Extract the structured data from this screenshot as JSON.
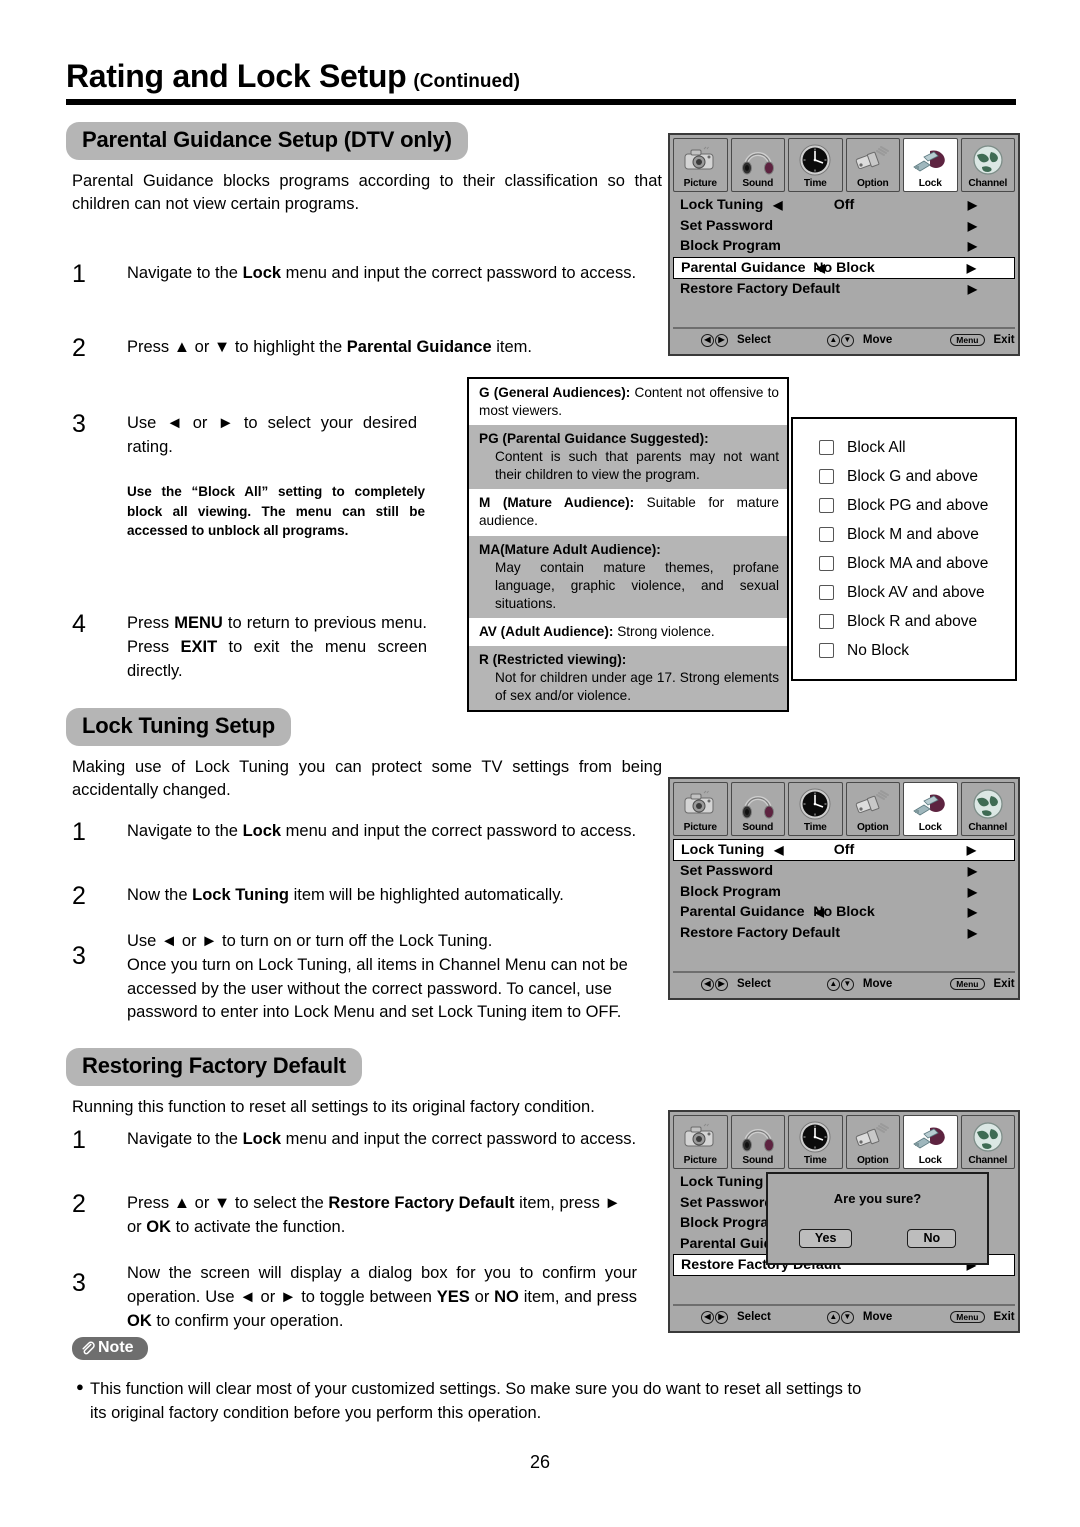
{
  "header": {
    "title": "Rating and Lock Setup",
    "continued": "(Continued)"
  },
  "sections": {
    "parental": {
      "pill": "Parental Guidance Setup (DTV only)",
      "intro": "Parental Guidance blocks programs according to their classification so that children can not view certain programs.",
      "steps": [
        {
          "num": "1",
          "text_html": "Navigate to the <b>Lock</b> menu and input the correct password to access."
        },
        {
          "num": "2",
          "text_html": "Press ▲ or ▼ to highlight the <b>Parental Guidance</b> item."
        },
        {
          "num": "3",
          "text_html": "Use ◄ or ► to select your desired rating."
        },
        {
          "num": "4",
          "text_html": "Press <b>MENU</b> to return to previous menu. Press <b>EXIT</b> to exit the menu screen directly."
        }
      ],
      "note_bold": "Use the “Block All” setting to completely block all viewing. The menu can still be accessed to unblock all programs."
    },
    "lock_tuning": {
      "pill": "Lock Tuning Setup",
      "intro": "Making use of Lock Tuning you can protect some TV settings from being accidentally changed.",
      "steps": [
        {
          "num": "1",
          "text_html": "Navigate to the <b>Lock</b> menu and input the correct password to access."
        },
        {
          "num": "2",
          "text_html": "Now the <b>Lock Tuning</b> item will be highlighted automatically."
        },
        {
          "num": "3",
          "text_html": "Use ◄ or ► to turn on or turn off the Lock Tuning.<br>Once you turn on Lock Tuning, all items in Channel Menu can not be accessed by the user without the correct password. To cancel, use password to enter into Lock Menu and set Lock Tuning item to OFF."
        }
      ]
    },
    "restoring": {
      "pill": "Restoring Factory Default",
      "intro": "Running this function to reset all settings to its original factory condition.",
      "steps": [
        {
          "num": "1",
          "text_html": "Navigate to the <b>Lock</b> menu and input the correct password to access."
        },
        {
          "num": "2",
          "text_html": "Press ▲ or ▼ to select the <b>Restore Factory Default</b> item, press ► or <b>OK</b> to activate the function."
        },
        {
          "num": "3",
          "text_html": "Now the screen will display a dialog box for you to confirm your operation. Use ◄ or ► to toggle between <b>YES</b> or <b>NO</b> item, and press <b>OK</b> to confirm your operation."
        }
      ]
    }
  },
  "ratings_table": {
    "rows": [
      {
        "code": "G (General Audiences):",
        "desc": " Content not offensive to most viewers.",
        "shaded": false,
        "hanging": false
      },
      {
        "code": "PG (Parental Guidance Suggested):",
        "desc": "Content is such that parents may not want their children to view the program.",
        "shaded": true,
        "hanging": true
      },
      {
        "code": "M (Mature Audience):",
        "desc": " Suitable for mature audience.",
        "shaded": false,
        "hanging": false
      },
      {
        "code": "MA(Mature Adult Audience):",
        "desc": " May contain mature themes, profane language, graphic violence, and sexual situations.",
        "shaded": true,
        "hanging": true
      },
      {
        "code": "AV (Adult Audience):",
        "desc": " Strong violence.",
        "shaded": false,
        "hanging": false
      },
      {
        "code": "R (Restricted viewing):",
        "desc": " Not for children under age 17. Strong elements of sex and/or violence.",
        "shaded": true,
        "hanging": true
      }
    ]
  },
  "block_options": [
    "Block All",
    "Block G and above",
    "Block PG and above",
    "Block M and above",
    "Block MA and above",
    "Block AV and above",
    "Block R and above",
    "No Block"
  ],
  "osd": {
    "tabs": [
      {
        "label": "Picture",
        "icon": "camera-icon",
        "active": false
      },
      {
        "label": "Sound",
        "icon": "headphones-icon",
        "active": false
      },
      {
        "label": "Time",
        "icon": "clock-icon",
        "active": false
      },
      {
        "label": "Option",
        "icon": "connector-icon",
        "active": false
      },
      {
        "label": "Lock",
        "icon": "padlock-icon",
        "active": true
      },
      {
        "label": "Channel",
        "icon": "globe-icon",
        "active": false
      }
    ],
    "footer": {
      "select": "Select",
      "move": "Move",
      "menu_key": "Menu",
      "exit": "Exit"
    },
    "menu1": {
      "rows": [
        {
          "name": "Lock Tuning",
          "left_arrow": true,
          "value": "Off",
          "right_arrow": true,
          "selected": false
        },
        {
          "name": "Set Password",
          "left_arrow": false,
          "value": "",
          "right_arrow": true,
          "selected": false
        },
        {
          "name": "Block Program",
          "left_arrow": false,
          "value": "",
          "right_arrow": true,
          "selected": false
        },
        {
          "name": "Parental Guidance",
          "left_arrow": true,
          "value": "No Block",
          "right_arrow": true,
          "selected": true
        },
        {
          "name": "Restore Factory Default",
          "left_arrow": false,
          "value": "",
          "right_arrow": true,
          "selected": false
        }
      ]
    },
    "menu2": {
      "rows": [
        {
          "name": "Lock Tuning",
          "left_arrow": true,
          "value": "Off",
          "right_arrow": true,
          "selected": true
        },
        {
          "name": "Set Password",
          "left_arrow": false,
          "value": "",
          "right_arrow": true,
          "selected": false
        },
        {
          "name": "Block Program",
          "left_arrow": false,
          "value": "",
          "right_arrow": true,
          "selected": false
        },
        {
          "name": "Parental Guidance",
          "left_arrow": true,
          "value": "No Block",
          "right_arrow": true,
          "selected": false
        },
        {
          "name": "Restore Factory Default",
          "left_arrow": false,
          "value": "",
          "right_arrow": true,
          "selected": false
        }
      ]
    },
    "menu3": {
      "rows": [
        {
          "name": "Lock Tuning",
          "left_arrow": false,
          "value": "",
          "right_arrow": false,
          "selected": false
        },
        {
          "name": "Set Password",
          "left_arrow": false,
          "value": "",
          "right_arrow": false,
          "selected": false
        },
        {
          "name": "Block Program",
          "left_arrow": false,
          "value": "",
          "right_arrow": false,
          "selected": false
        },
        {
          "name": "Parental Guidance",
          "left_arrow": false,
          "value": "",
          "right_arrow": false,
          "selected": false
        },
        {
          "name": "Restore Factory Default",
          "left_arrow": false,
          "value": "",
          "right_arrow": true,
          "selected": true
        }
      ],
      "dialog": {
        "question": "Are you sure?",
        "yes": "Yes",
        "no": "No"
      }
    }
  },
  "note": {
    "badge": "Note",
    "text": "This function will clear most of your customized settings.  So make sure you do want to reset all settings to its original factory condition before you perform this operation."
  },
  "page_number": "26",
  "colors": {
    "pill_gray": "#b5b5b5",
    "osd_gray": "#a9a9a9",
    "note_gray": "#6e6e6e"
  }
}
